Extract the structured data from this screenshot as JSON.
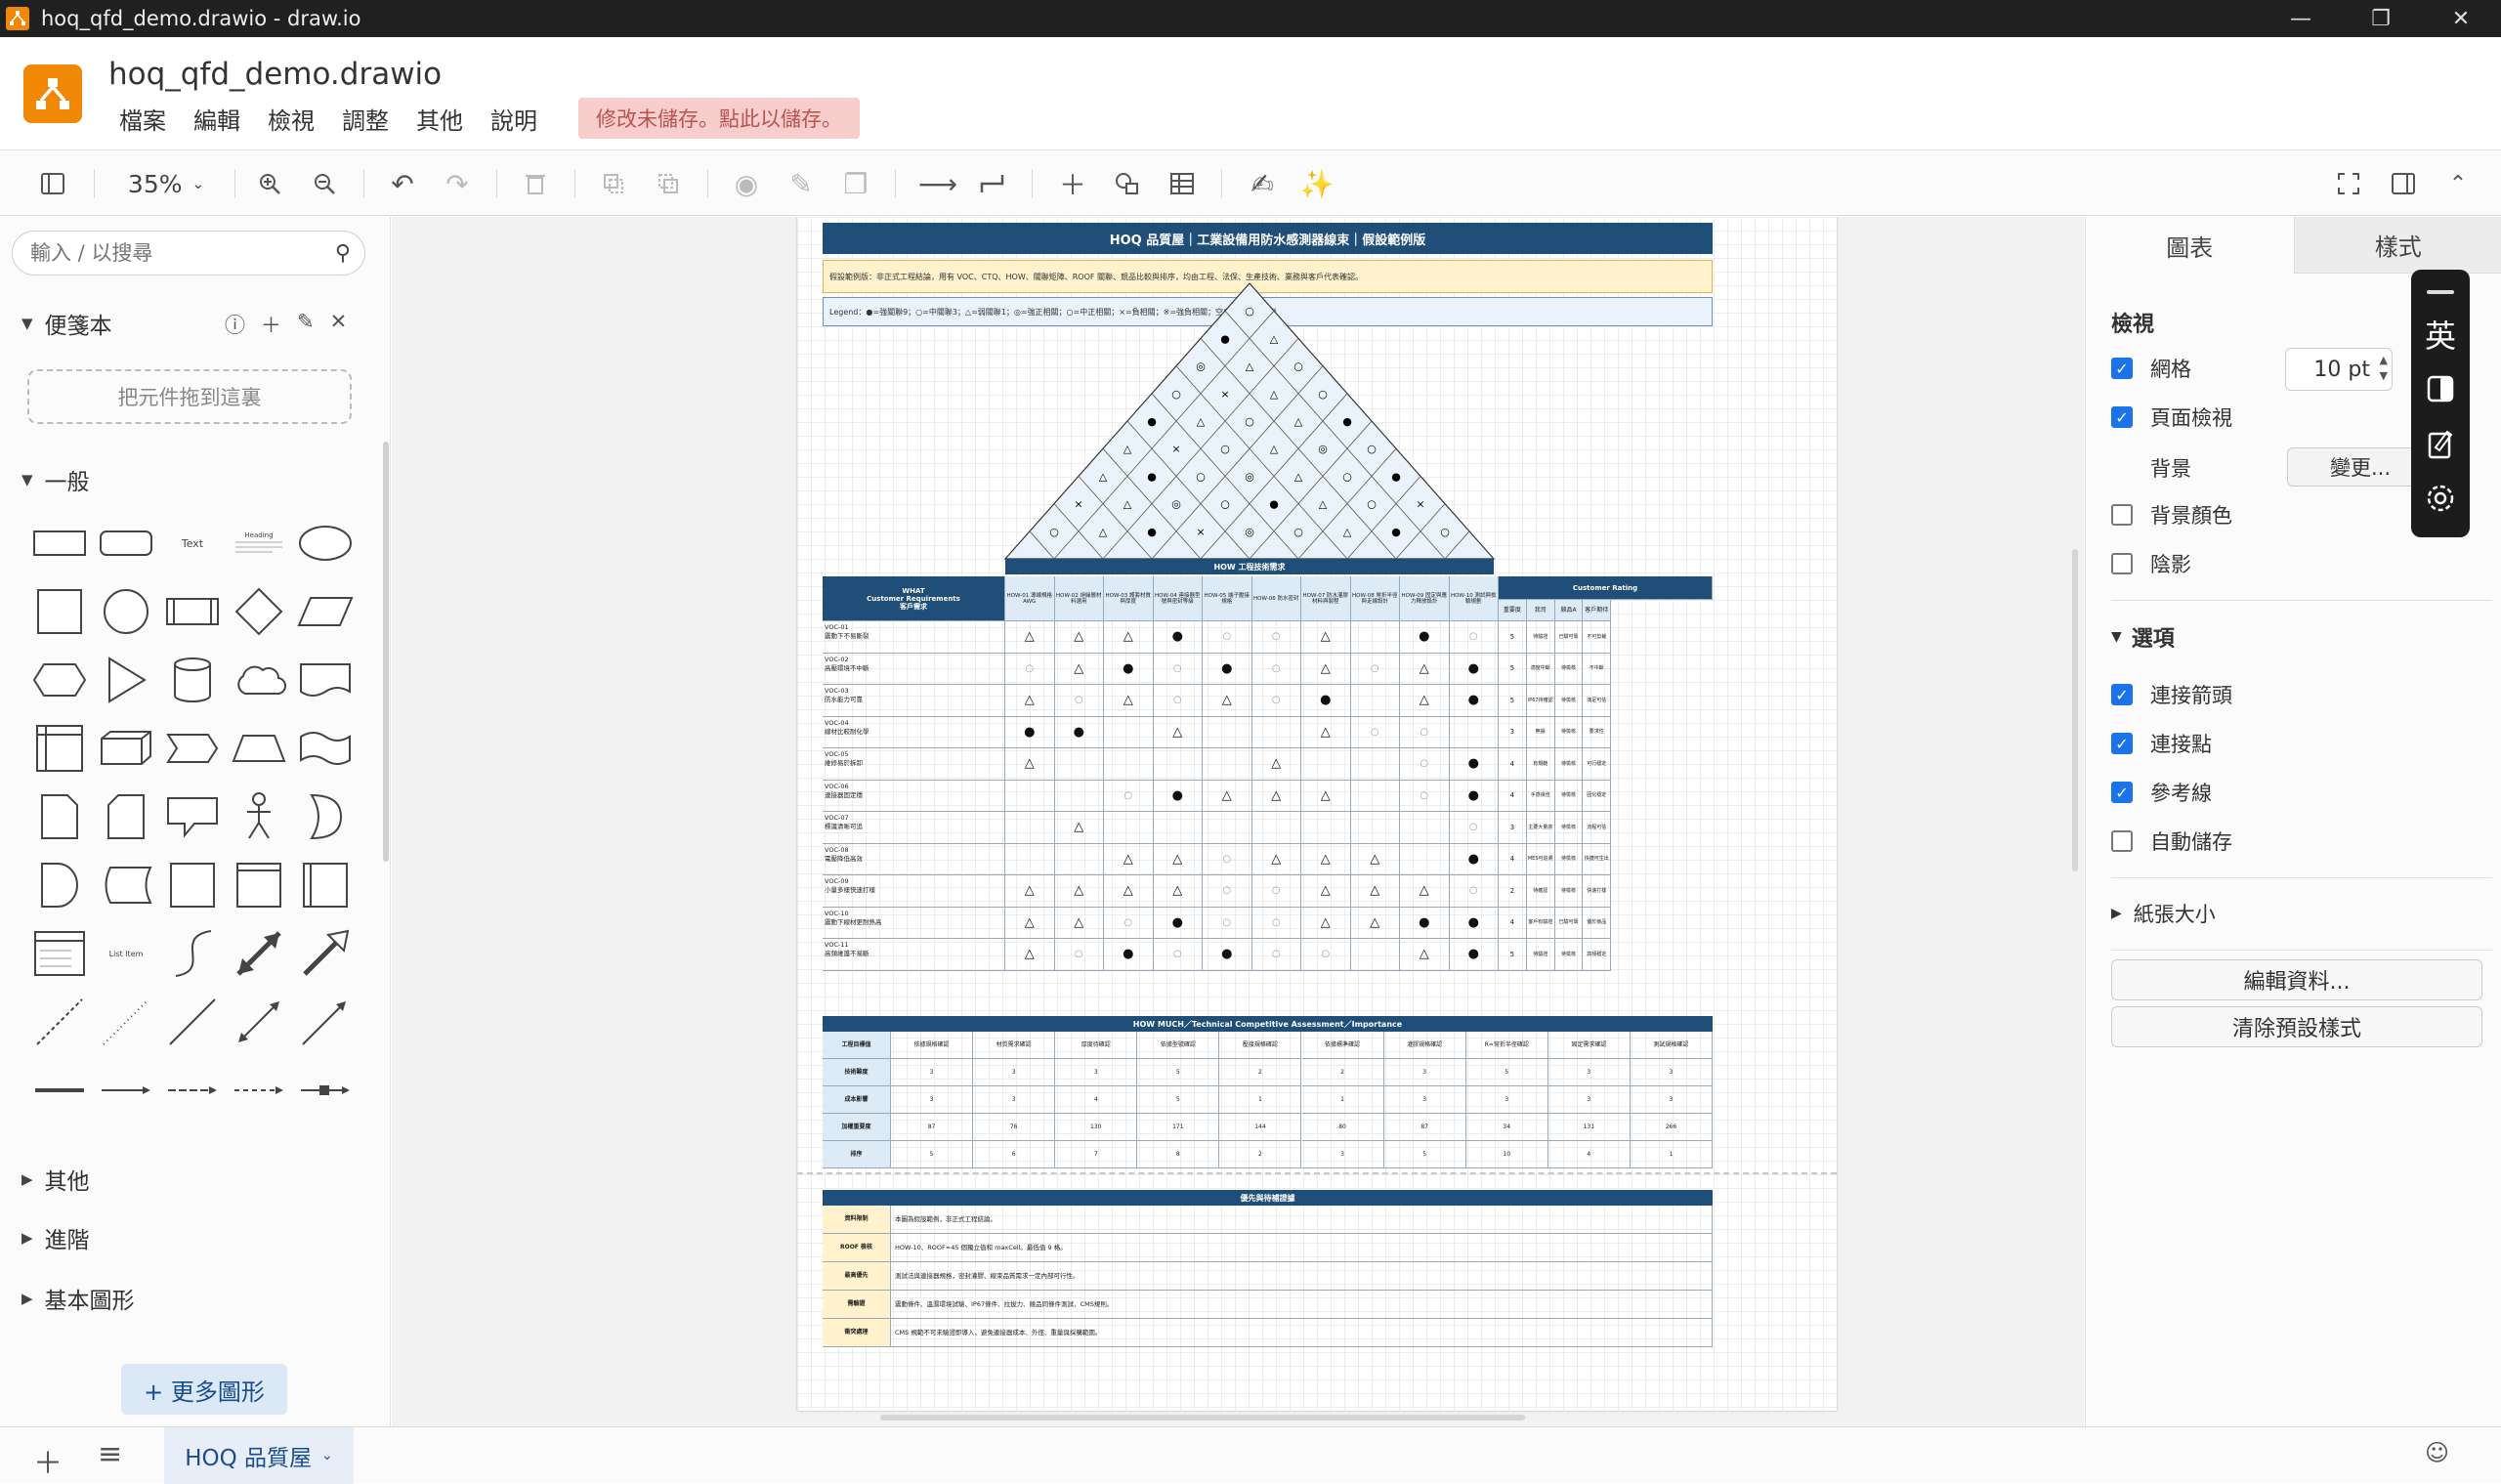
{
  "window": {
    "title": "hoq_qfd_demo.drawio - draw.io",
    "controls": [
      "minimize",
      "restore",
      "close"
    ]
  },
  "header": {
    "filename": "hoq_qfd_demo.drawio",
    "menus": [
      "檔案",
      "編輯",
      "檢視",
      "調整",
      "其他",
      "說明"
    ],
    "unsaved_notice": "修改未儲存。點此以儲存。"
  },
  "toolbar": {
    "zoom": "35%"
  },
  "left_panel": {
    "search_placeholder": "輸入 / 以搜尋",
    "scratchpad_title": "便箋本",
    "dropzone_text": "把元件拖到這裏",
    "general_title": "一般",
    "shape_text_label": "Text",
    "shape_heading_label": "Heading",
    "shape_listitem_label": "List Item",
    "other_sections": [
      "其他",
      "進階",
      "基本圖形"
    ],
    "more_shapes": "+ 更多圖形"
  },
  "diagram": {
    "title": "HOQ 品質屋｜工業設備用防水感測器線束｜假設範例版",
    "note": "假設範例版：非正式工程結論，用有 VOC、CTQ、HOW、關聯矩陣、ROOF 關聯、競品比較與排序，均由工程、法保、生產技術、業務與客戶代表確認。",
    "legend": "Legend：●=強關聯9；○=中關聯3；△=弱關聯1；◎=強正相關；○=中正相關；×=負相關；※=強負相關；空白=無明顯關聯",
    "how_header": "HOW 工程技術需求",
    "what_header": [
      "WHAT",
      "Customer Requirements",
      "客戶需求"
    ],
    "hows": [
      "HOW-01 導線規格 AWG",
      "HOW-02 絕緣層材料選用",
      "HOW-03 護套材質與厚度",
      "HOW-04 連接器型號與密封等級",
      "HOW-05 端子壓接規格",
      "HOW-06 防水密封",
      "HOW-07 防水灌膠材料與製程",
      "HOW-08 彎折半徑與走線設計",
      "HOW-09 固定與應力釋放設計",
      "HOW-10 測試與檢驗規劃"
    ],
    "rating_header": "Customer Rating",
    "rating_cols": [
      "重要度",
      "我司",
      "競品A",
      "客戶期待"
    ],
    "rows": [
      {
        "id": "VOC-01",
        "text": "震動下不易斷裂",
        "rel": [
          "△",
          "△",
          "△",
          "●",
          "○",
          "○",
          "△",
          "",
          "●",
          "○"
        ],
        "imp": "5",
        "r": [
          "待驗證",
          "已驗可靠",
          "不可剪裁"
        ]
      },
      {
        "id": "VOC-02",
        "text": "高壓環境不中斷",
        "rel": [
          "○",
          "△",
          "●",
          "○",
          "●",
          "○",
          "△",
          "○",
          "△",
          "●"
        ],
        "imp": "5",
        "r": [
          "適度中斷",
          "待檢核",
          "不中斷"
        ]
      },
      {
        "id": "VOC-03",
        "text": "防水能力可靠",
        "rel": [
          "△",
          "○",
          "△",
          "○",
          "△",
          "○",
          "●",
          "",
          "△",
          "●"
        ],
        "imp": "5",
        "r": [
          "IP67待確認",
          "待檢核",
          "滿足可信"
        ]
      },
      {
        "id": "VOC-04",
        "text": "線材比較耐化學",
        "rel": [
          "●",
          "●",
          "",
          "△",
          "",
          "",
          "△",
          "○",
          "○",
          ""
        ],
        "imp": "3",
        "r": [
          "無據",
          "待檢核",
          "要求性"
        ]
      },
      {
        "id": "VOC-05",
        "text": "維修易於拆卸",
        "rel": [
          "△",
          "",
          "",
          "",
          "",
          "△",
          "",
          "",
          "○",
          "●"
        ],
        "imp": "4",
        "r": [
          "有規範",
          "待檢核",
          "可行穩定"
        ]
      },
      {
        "id": "VOC-06",
        "text": "連接器固定穩",
        "rel": [
          "",
          "",
          "○",
          "●",
          "△",
          "△",
          "△",
          "",
          "○",
          "●"
        ],
        "imp": "4",
        "r": [
          "手感良佳",
          "待檢核",
          "固化穩定"
        ]
      },
      {
        "id": "VOC-07",
        "text": "標識清晰可追",
        "rel": [
          "",
          "△",
          "",
          "",
          "",
          "",
          "",
          "",
          "",
          "○"
        ],
        "imp": "3",
        "r": [
          "主要大量詢",
          "待檢核",
          "流程可信"
        ]
      },
      {
        "id": "VOC-08",
        "text": "電壓降低高效",
        "rel": [
          "",
          "",
          "△",
          "△",
          "○",
          "△",
          "△",
          "△",
          "",
          "●"
        ],
        "imp": "4",
        "r": [
          "MES可追溯",
          "待檢核",
          "快捷可生出"
        ]
      },
      {
        "id": "VOC-09",
        "text": "小量多樣快速打樣",
        "rel": [
          "△",
          "△",
          "△",
          "△",
          "○",
          "○",
          "△",
          "△",
          "△",
          "○"
        ],
        "imp": "2",
        "r": [
          "待確認",
          "待檢核",
          "快速打樣"
        ]
      },
      {
        "id": "VOC-10",
        "text": "震動下線材更耐熱高",
        "rel": [
          "△",
          "△",
          "○",
          "●",
          "○",
          "○",
          "△",
          "△",
          "●",
          "●"
        ],
        "imp": "4",
        "r": [
          "客戶有驗證",
          "已驗可靠",
          "優於競品"
        ]
      },
      {
        "id": "VOC-11",
        "text": "高頻維護不易斷",
        "rel": [
          "△",
          "○",
          "●",
          "○",
          "●",
          "○",
          "○",
          "",
          "△",
          "●"
        ],
        "imp": "5",
        "r": [
          "待驗證",
          "待檢核",
          "高頻穩定"
        ]
      }
    ],
    "howmuch_title": "HOW MUCH／Technical Competitive Assessment／Importance",
    "howmuch_rows": [
      {
        "label": "工程目標值",
        "vals": [
          "依據規格確認",
          "材質需求確認",
          "厚度待確認",
          "依據型號確認",
          "壓接規格確認",
          "依據標準確認",
          "灌膠規格確認",
          "R=彎折半徑確認",
          "固定需求確認",
          "測試規格確認"
        ]
      },
      {
        "label": "技術難度",
        "vals": [
          "3",
          "3",
          "3",
          "5",
          "2",
          "2",
          "3",
          "5",
          "3",
          "3"
        ]
      },
      {
        "label": "成本影響",
        "vals": [
          "3",
          "3",
          "4",
          "5",
          "1",
          "1",
          "3",
          "3",
          "3",
          "3"
        ]
      },
      {
        "label": "加權重要度",
        "vals": [
          "87",
          "76",
          "130",
          "171",
          "144",
          "80",
          "87",
          "34",
          "131",
          "266"
        ]
      },
      {
        "label": "排序",
        "vals": [
          "5",
          "6",
          "7",
          "8",
          "2",
          "3",
          "5",
          "10",
          "4",
          "1"
        ]
      }
    ],
    "findings_title": "優先與待補證據",
    "findings": [
      {
        "label": "資料限制",
        "text": "本圖為假設範例，非正式工程結論。"
      },
      {
        "label": "ROOF 檢核",
        "text": "HOW-10、ROOF=45 個獨立值和 maxCell。最低值 9 格。"
      },
      {
        "label": "最高優先",
        "text": "測試法與連接器規格，密封灌膠、線束品質需求一定內部可行性。"
      },
      {
        "label": "需驗證",
        "text": "震動條件、溫濕環境試驗、IP67條件、拉拔力、競品同條件測試、CMS規則。"
      },
      {
        "label": "衝突處理",
        "text": "CMS 規範不可未驗證即導入，避免連接器成本、外徑、重量與採購範圍。"
      }
    ]
  },
  "right_panel": {
    "tabs": [
      "圖表",
      "樣式"
    ],
    "view_title": "檢視",
    "grid_label": "網格",
    "grid_size": "10 pt",
    "page_view_label": "頁面檢視",
    "background_label": "背景",
    "change_button": "變更...",
    "bg_color_label": "背景顏色",
    "shadow_label": "陰影",
    "options_title": "選項",
    "opt_connection_arrows": "連接箭頭",
    "opt_connection_points": "連接點",
    "opt_guides": "參考線",
    "opt_autosave": "自動儲存",
    "paper_size": "紙張大小",
    "edit_data": "編輯資料...",
    "clear_style": "清除預設樣式",
    "checks": {
      "grid": true,
      "page_view": true,
      "bg_color": false,
      "shadow": false,
      "arrows": true,
      "points": true,
      "guides": true,
      "autosave": false
    }
  },
  "ime": {
    "lang": "英"
  },
  "bottom": {
    "page_tab": "HOQ 品質屋"
  }
}
